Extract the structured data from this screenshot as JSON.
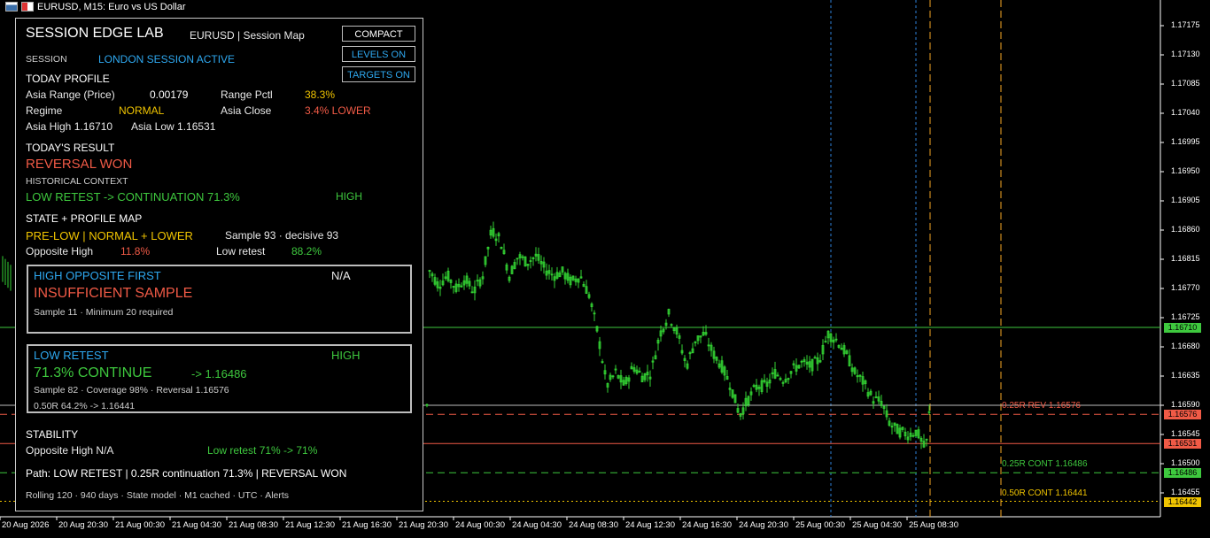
{
  "window": {
    "title": "EURUSD, M15:  Euro vs US Dollar"
  },
  "colors": {
    "green_candle": "#33d433",
    "level_high": "#3ec83e",
    "level_low": "#f05a46",
    "asia_orange": "#f5a623",
    "session_blue": "#2e7fd8"
  },
  "panel": {
    "title": "SESSION EDGE LAB",
    "subtitle": "EURUSD  |  Session Map",
    "buttons": {
      "compact": "COMPACT",
      "levels": "LEVELS ON",
      "targets": "TARGETS ON"
    },
    "session_label": "SESSION",
    "session_value": "LONDON SESSION ACTIVE",
    "today_profile": {
      "header": "TODAY PROFILE",
      "asia_range_label": "Asia Range (Price)",
      "asia_range_value": "0.00179",
      "range_pctl_label": "Range Pctl",
      "range_pctl_value": "38.3%",
      "regime_label": "Regime",
      "regime_value": "NORMAL",
      "asia_close_label": "Asia Close",
      "asia_close_value": "3.4%  LOWER",
      "asia_high": "Asia High  1.16710",
      "asia_low": "Asia Low  1.16531"
    },
    "todays_result": {
      "header": "TODAY'S RESULT",
      "value": "REVERSAL WON",
      "context_label": "HISTORICAL CONTEXT",
      "context_value": "LOW RETEST -> CONTINUATION 71.3%",
      "context_rating": "HIGH"
    },
    "state_map": {
      "header": "STATE + PROFILE MAP",
      "state": "PRE-LOW | NORMAL + LOWER",
      "sample": "Sample 93  ·  decisive 93",
      "opp_high_label": "Opposite High",
      "opp_high_value": "11.8%",
      "low_retest_label": "Low retest",
      "low_retest_value": "88.2%"
    },
    "box_high": {
      "title": "HIGH OPPOSITE FIRST",
      "rating": "N/A",
      "value": "INSUFFICIENT SAMPLE",
      "detail": "Sample 11  ·  Minimum 20 required"
    },
    "box_low": {
      "title": "LOW RETEST",
      "rating": "HIGH",
      "value": "71.3% CONTINUE",
      "target": "->  1.16486",
      "detail": "Sample 82  ·  Coverage 98%  ·  Reversal 1.16576",
      "detail2": "0.50R  64.2% -> 1.16441"
    },
    "stability": {
      "header": "STABILITY",
      "opp_high": "Opposite High  N/A",
      "low_retest": "Low retest  71% -> 71%"
    },
    "path": "Path: LOW RETEST | 0.25R continuation 71.3% | REVERSAL WON",
    "footer": "Rolling 120  ·  940 days  ·  State model  ·  M1 cached  ·  UTC  ·  Alerts"
  },
  "chart_data": {
    "type": "candlestick",
    "symbol": "EURUSD",
    "timeframe": "M15",
    "ylim": [
      1.1642,
      1.172
    ],
    "y_ticks": [
      "1.17175",
      "1.17130",
      "1.17085",
      "1.17040",
      "1.16995",
      "1.16950",
      "1.16905",
      "1.16860",
      "1.16815",
      "1.16770",
      "1.16725",
      "1.16680",
      "1.16635",
      "1.16590",
      "1.16545",
      "1.16500",
      "1.16455"
    ],
    "x_ticks": [
      "20 Aug 2026",
      "20 Aug 20:30",
      "21 Aug 00:30",
      "21 Aug 04:30",
      "21 Aug 08:30",
      "21 Aug 12:30",
      "21 Aug 16:30",
      "21 Aug 20:30",
      "24 Aug 00:30",
      "24 Aug 04:30",
      "24 Aug 08:30",
      "24 Aug 12:30",
      "24 Aug 16:30",
      "24 Aug 20:30",
      "25 Aug 00:30",
      "25 Aug 04:30",
      "25 Aug 08:30"
    ],
    "price_tags": [
      {
        "value": "1.16710",
        "bg": "#3ec83e"
      },
      {
        "value": "1.16576",
        "bg": "#f05a46"
      },
      {
        "value": "1.16531",
        "bg": "#f05a46"
      },
      {
        "value": "1.16486",
        "bg": "#3ec83e"
      },
      {
        "value": "1.16442",
        "bg": "#f0c400"
      }
    ],
    "levels": [
      {
        "label": "0.25R REV  1.16576",
        "color": "#f05a46"
      },
      {
        "label": "0.25R CONT  1.16486",
        "color": "#3ec83e"
      },
      {
        "label": "0.50R CONT  1.16441",
        "color": "#f0c400"
      }
    ]
  }
}
